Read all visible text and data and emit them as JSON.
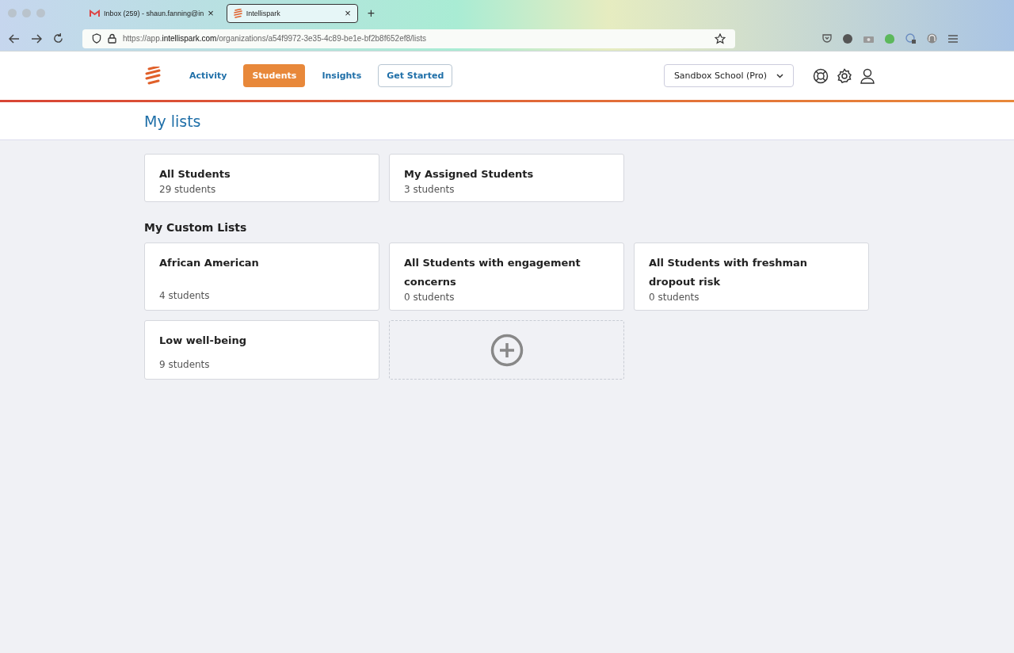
{
  "browser": {
    "tabs": [
      {
        "title": "Inbox (259) - shaun.fanning@in",
        "close": "×",
        "selected": false,
        "kind": "mail"
      },
      {
        "title": "Intellispark",
        "close": "×",
        "selected": true,
        "kind": "app"
      }
    ],
    "new_tab": "+",
    "url": "https://app.**intellispark.com**/organizations/a54f9972-3e35-4c89-be1e-bf2b8f652ef8/lists"
  },
  "nav": {
    "items": [
      {
        "label": "Activity",
        "selected": false,
        "kind": "link"
      },
      {
        "label": "Students",
        "selected": true,
        "kind": "link"
      },
      {
        "label": "Insights",
        "selected": false,
        "kind": "link"
      },
      {
        "label": "Get Started",
        "selected": false,
        "kind": "outlined"
      }
    ],
    "school": "Sandbox School (Pro)"
  },
  "page_title": "My lists",
  "lists": [
    {
      "name": "All Students",
      "count": "29 students"
    },
    {
      "name": "My Assigned Students",
      "count": "3 students"
    }
  ],
  "custom_heading": "My Custom Lists",
  "custom_lists": [
    {
      "name": "African American",
      "count": "4 students"
    },
    {
      "name": "All Students with engagement concerns",
      "count": "0 students"
    },
    {
      "name": "All Students with freshman dropout risk",
      "count": "0 students"
    },
    {
      "name": "Low well-being",
      "count": "9 students"
    }
  ]
}
